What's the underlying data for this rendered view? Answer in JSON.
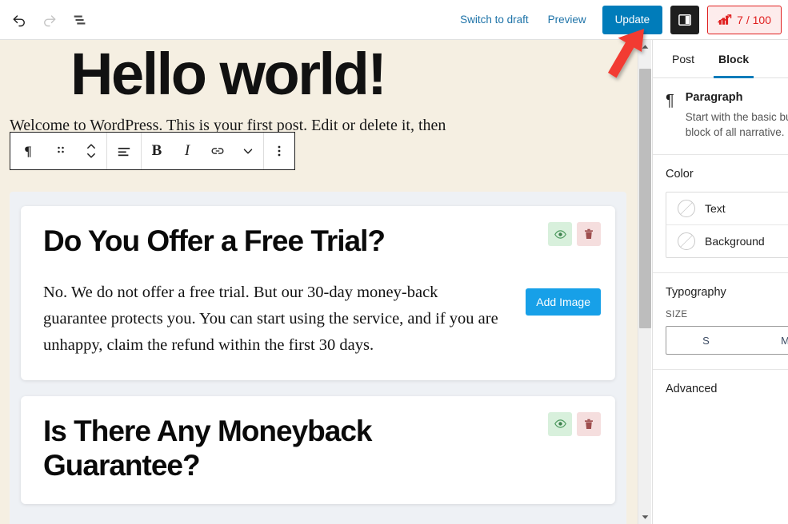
{
  "topbar": {
    "undo_icon": "undo-arrow-icon",
    "redo_icon": "redo-arrow-icon",
    "list_view_icon": "document-overview-icon",
    "switch_to_draft_label": "Switch to draft",
    "preview_label": "Preview",
    "update_label": "Update",
    "settings_icon": "sidebar-toggle-icon",
    "seo_icon": "seo-bar-chart-icon",
    "seo_score": "7 / 100",
    "accent_blue": "#007cba",
    "seo_red": "#e02020"
  },
  "block_toolbar": {
    "paragraph_icon": "paragraph-pilcrow-icon",
    "drag_icon": "drag-handle-icon",
    "move_icon": "move-up-down-icon",
    "align_icon": "text-align-icon",
    "bold_label": "B",
    "italic_label": "I",
    "link_icon": "link-icon",
    "more_formats_icon": "chevron-down-icon",
    "options_icon": "more-options-vertical-icon"
  },
  "canvas": {
    "background_color": "#f5efe2",
    "post_title": "Hello world!",
    "post_paragraph": "Welcome to WordPress. This is your first post. Edit or delete it, then start writing!",
    "faq_background_color": "#eef1f5",
    "faq_cards": [
      {
        "question": "Do You Offer a Free Trial?",
        "answer": "No. We do not offer a free trial. But our 30-day money-back guarantee protects you. You can start using the service, and if you are unhappy, claim the refund within the first 30 days.",
        "add_image_label": "Add Image",
        "eye_icon": "eye-visibility-icon",
        "trash_icon": "trash-delete-icon"
      },
      {
        "question": "Is There Any Moneyback Guarantee?",
        "answer": "",
        "add_image_label": "",
        "eye_icon": "eye-visibility-icon",
        "trash_icon": "trash-delete-icon"
      }
    ]
  },
  "scrollbar": {
    "up_icon": "scroll-up-arrow-icon",
    "down_icon": "scroll-down-arrow-icon"
  },
  "sidebar": {
    "tabs": [
      {
        "label": "Post",
        "active": false
      },
      {
        "label": "Block",
        "active": true
      }
    ],
    "block": {
      "icon": "paragraph-pilcrow-icon",
      "title": "Paragraph",
      "description": "Start with the basic building block of all narrative."
    },
    "color": {
      "section_title": "Color",
      "rows": [
        {
          "label": "Text",
          "icon": "color-swatch-empty-icon"
        },
        {
          "label": "Background",
          "icon": "color-swatch-empty-icon"
        }
      ]
    },
    "typography": {
      "section_title": "Typography",
      "size_label": "SIZE",
      "sizes": [
        "S",
        "M"
      ]
    },
    "advanced_label": "Advanced"
  },
  "annotation": {
    "arrow_icon": "red-pointer-arrow-icon",
    "arrow_color": "#f23b30"
  }
}
